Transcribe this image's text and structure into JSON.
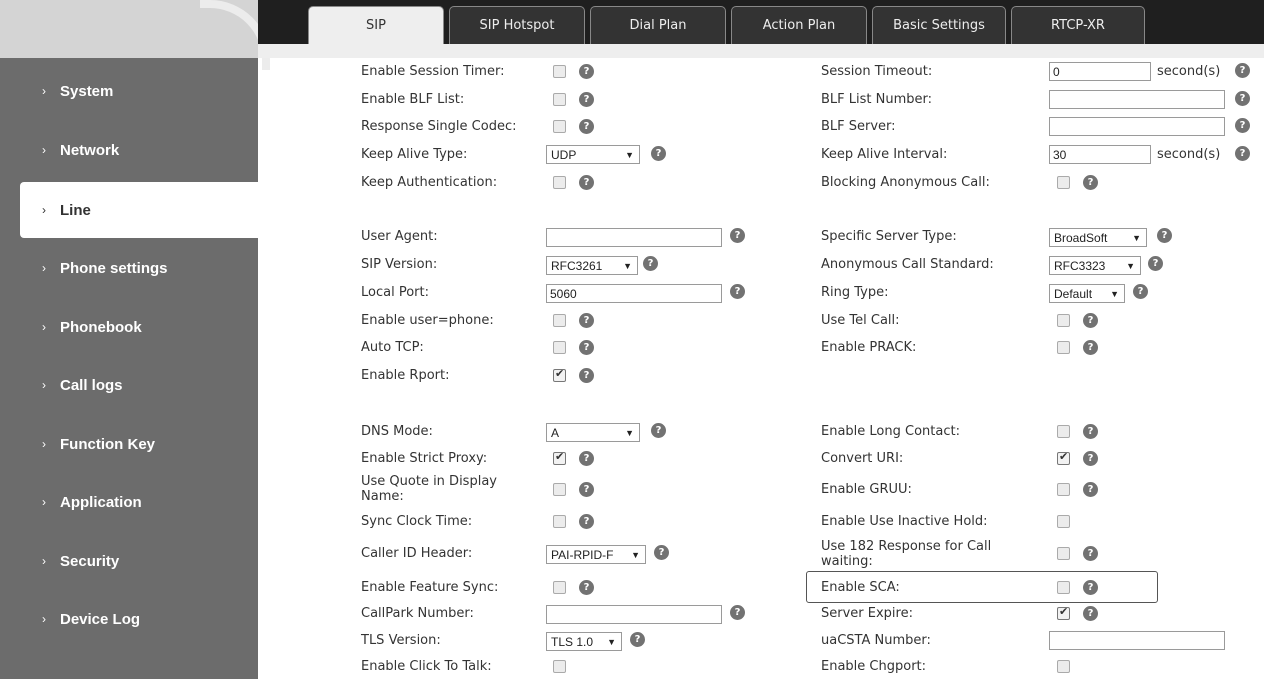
{
  "nav": {
    "items": [
      {
        "label": "System"
      },
      {
        "label": "Network"
      },
      {
        "label": "Line",
        "active": true
      },
      {
        "label": "Phone settings"
      },
      {
        "label": "Phonebook"
      },
      {
        "label": "Call logs"
      },
      {
        "label": "Function Key"
      },
      {
        "label": "Application"
      },
      {
        "label": "Security"
      },
      {
        "label": "Device Log"
      }
    ]
  },
  "tabs": [
    {
      "label": "SIP",
      "active": true
    },
    {
      "label": "SIP Hotspot"
    },
    {
      "label": "Dial Plan"
    },
    {
      "label": "Action Plan"
    },
    {
      "label": "Basic Settings"
    },
    {
      "label": "RTCP-XR"
    }
  ],
  "form": {
    "enable_session_timer": {
      "label": "Enable Session Timer:",
      "checked": false
    },
    "session_timeout": {
      "label": "Session Timeout:",
      "value": "0",
      "unit": "second(s)"
    },
    "enable_blf_list": {
      "label": "Enable BLF List:",
      "checked": false
    },
    "blf_list_number": {
      "label": "BLF List Number:",
      "value": ""
    },
    "response_single_codec": {
      "label": "Response Single Codec:",
      "checked": false
    },
    "blf_server": {
      "label": "BLF Server:",
      "value": ""
    },
    "keep_alive_type": {
      "label": "Keep Alive Type:",
      "value": "UDP"
    },
    "keep_alive_interval": {
      "label": "Keep Alive Interval:",
      "value": "30",
      "unit": "second(s)"
    },
    "keep_authentication": {
      "label": "Keep Authentication:",
      "checked": false
    },
    "blocking_anonymous_call": {
      "label": "Blocking Anonymous Call:",
      "checked": false
    },
    "user_agent": {
      "label": "User Agent:",
      "value": ""
    },
    "specific_server_type": {
      "label": "Specific Server Type:",
      "value": "BroadSoft"
    },
    "sip_version": {
      "label": "SIP Version:",
      "value": "RFC3261"
    },
    "anonymous_call_standard": {
      "label": "Anonymous Call Standard:",
      "value": "RFC3323"
    },
    "local_port": {
      "label": "Local Port:",
      "value": "5060"
    },
    "ring_type": {
      "label": "Ring Type:",
      "value": "Default"
    },
    "enable_user_phone": {
      "label": "Enable user=phone:",
      "checked": false
    },
    "use_tel_call": {
      "label": "Use Tel Call:",
      "checked": false
    },
    "auto_tcp": {
      "label": "Auto TCP:",
      "checked": false
    },
    "enable_prack": {
      "label": "Enable PRACK:",
      "checked": false
    },
    "enable_rport": {
      "label": "Enable Rport:",
      "checked": true
    },
    "dns_mode": {
      "label": "DNS Mode:",
      "value": "A"
    },
    "enable_long_contact": {
      "label": "Enable Long Contact:",
      "checked": false
    },
    "enable_strict_proxy": {
      "label": "Enable Strict Proxy:",
      "checked": true
    },
    "convert_uri": {
      "label": "Convert URI:",
      "checked": true
    },
    "use_quote_display_name": {
      "label": "Use Quote in Display Name:",
      "checked": false
    },
    "enable_gruu": {
      "label": "Enable GRUU:",
      "checked": false
    },
    "sync_clock_time": {
      "label": "Sync Clock Time:",
      "checked": false
    },
    "enable_use_inactive_hold": {
      "label": "Enable Use Inactive Hold:",
      "checked": false
    },
    "caller_id_header": {
      "label": "Caller ID Header:",
      "value": "PAI-RPID-F"
    },
    "use_182_response": {
      "label": "Use 182 Response for Call waiting:",
      "checked": false
    },
    "enable_feature_sync": {
      "label": "Enable Feature Sync:",
      "checked": false
    },
    "enable_sca": {
      "label": "Enable SCA:",
      "checked": false
    },
    "callpark_number": {
      "label": "CallPark Number:",
      "value": ""
    },
    "server_expire": {
      "label": "Server Expire:",
      "checked": true
    },
    "tls_version": {
      "label": "TLS Version:",
      "value": "TLS 1.0"
    },
    "uacsta_number": {
      "label": "uaCSTA Number:",
      "value": ""
    },
    "enable_click_to_talk": {
      "label": "Enable Click To Talk:",
      "checked": false
    },
    "enable_chgport": {
      "label": "Enable Chgport:",
      "checked": false
    }
  },
  "icons": {
    "help": "?",
    "nav_arrow": "›",
    "select_caret": "▼"
  }
}
